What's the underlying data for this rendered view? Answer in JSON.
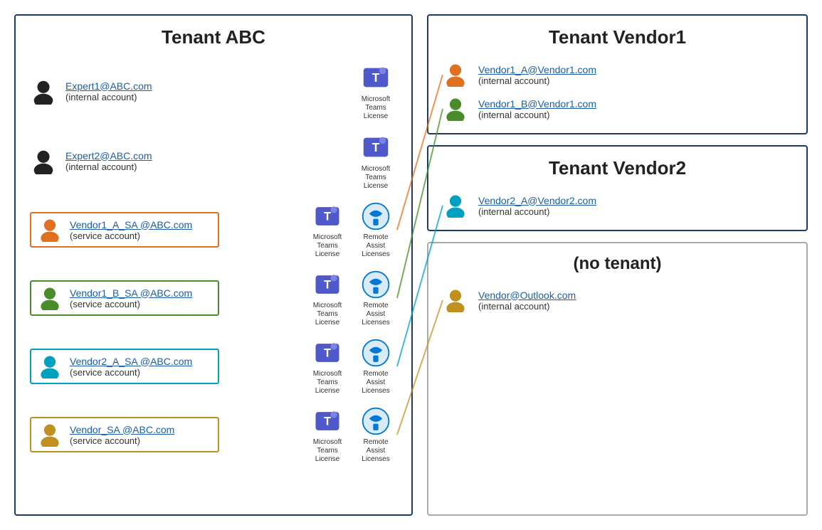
{
  "tenantABC": {
    "title": "Tenant ABC",
    "users": [
      {
        "id": "expert1",
        "email": "Expert1@ABC.com",
        "type": "(internal account)",
        "color": "#222",
        "boxStyle": null,
        "licenses": [
          "teams"
        ]
      },
      {
        "id": "expert2",
        "email": "Expert2@ABC.com",
        "type": "(internal account)",
        "color": "#222",
        "boxStyle": null,
        "licenses": [
          "teams"
        ]
      },
      {
        "id": "vendor1a_sa",
        "email": "Vendor1_A_SA @ABC.com",
        "type": "(service account)",
        "color": "#e07020",
        "boxStyle": "orange",
        "licenses": [
          "teams",
          "remote"
        ]
      },
      {
        "id": "vendor1b_sa",
        "email": "Vendor1_B_SA @ABC.com",
        "type": "(service account)",
        "color": "#4a8c2a",
        "boxStyle": "green",
        "licenses": [
          "teams",
          "remote"
        ]
      },
      {
        "id": "vendor2a_sa",
        "email": "Vendor2_A_SA @ABC.com",
        "type": "(service account)",
        "color": "#00a0c0",
        "boxStyle": "cyan",
        "licenses": [
          "teams",
          "remote"
        ]
      },
      {
        "id": "vendor_sa",
        "email": "Vendor_SA @ABC.com",
        "type": "(service account)",
        "color": "#c09020",
        "boxStyle": "gold",
        "licenses": [
          "teams",
          "remote"
        ]
      }
    ]
  },
  "tenantVendor1": {
    "title": "Tenant Vendor1",
    "users": [
      {
        "id": "vendor1a",
        "email": "Vendor1_A@Vendor1.com",
        "type": "(internal account)",
        "color": "#e07020"
      },
      {
        "id": "vendor1b",
        "email": "Vendor1_B@Vendor1.com",
        "type": "(internal account)",
        "color": "#4a8c2a"
      }
    ]
  },
  "tenantVendor2": {
    "title": "Tenant Vendor2",
    "users": [
      {
        "id": "vendor2a",
        "email": "Vendor2_A@Vendor2.com",
        "type": "(internal account)",
        "color": "#00a0c0"
      }
    ]
  },
  "noTenant": {
    "title": "(no tenant)",
    "users": [
      {
        "id": "vendor_outlook",
        "email": "Vendor@Outlook.com",
        "type": "(internal account)",
        "color": "#c09020"
      }
    ]
  },
  "licenses": {
    "teams": "Microsoft Teams License",
    "remote": "Remote Assist Licenses"
  }
}
